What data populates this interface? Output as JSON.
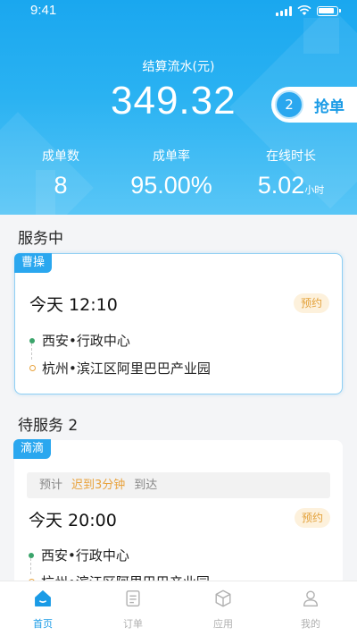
{
  "status_bar": {
    "time": "9:41"
  },
  "header": {
    "earnings_label": "结算流水(元)",
    "earnings_value": "349.32",
    "grab_button": {
      "count": "2",
      "label": "抢单"
    },
    "stats": [
      {
        "label": "成单数",
        "value": "8",
        "unit": ""
      },
      {
        "label": "成单率",
        "value": "95.00%",
        "unit": ""
      },
      {
        "label": "在线时长",
        "value": "5.02",
        "unit": "小时"
      }
    ]
  },
  "in_service": {
    "title": "服务中",
    "order": {
      "platform": "曹操",
      "time": "今天 12:10",
      "badge": "预约",
      "from": "西安•行政中心",
      "to": "杭州•滨江区阿里巴巴产业园"
    }
  },
  "pending": {
    "title": "待服务 2",
    "order": {
      "platform": "滴滴",
      "eta_prefix": "预计",
      "eta_late": "迟到3分钟",
      "eta_suffix": "到达",
      "time": "今天 20:00",
      "badge": "预约",
      "from": "西安•行政中心",
      "to": "杭州•滨江区阿里巴巴产业园"
    }
  },
  "tabbar": [
    {
      "label": "首页",
      "icon": "home-icon",
      "active": true
    },
    {
      "label": "订单",
      "icon": "order-list-icon",
      "active": false
    },
    {
      "label": "应用",
      "icon": "cube-icon",
      "active": false
    },
    {
      "label": "我的",
      "icon": "user-icon",
      "active": false
    }
  ],
  "colors": {
    "accent": "#1a9be6",
    "badge_text": "#e3a13a",
    "late": "#e8a23c",
    "start_dot": "#3ba46b"
  }
}
